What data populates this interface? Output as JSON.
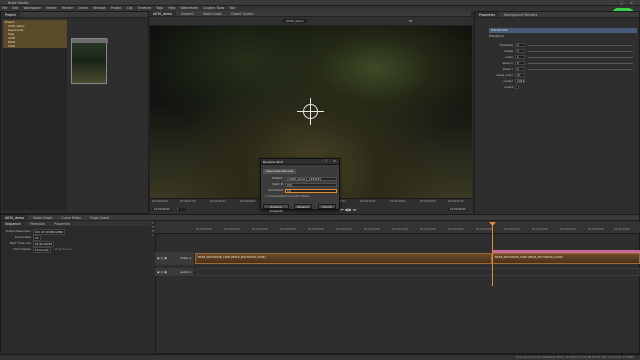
{
  "app": {
    "title": "Nuke Studio"
  },
  "menu": [
    "File",
    "Edit",
    "Workspace",
    "Viewer",
    "Render",
    "Cache",
    "Window",
    "Project",
    "Clip",
    "Timeline",
    "Tags",
    "Help",
    "Watermark",
    "Custom Tools",
    "Tool"
  ],
  "project_panel": {
    "tabs": [
      "Project"
    ],
    "bins": [
      "Project",
      "A030_demo",
      "Sequences",
      "Tags",
      "A030",
      "B001",
      "C001"
    ]
  },
  "viewer": {
    "tabs": [
      "A030_demo",
      "Viewer1",
      "Node Graph",
      "Export Queue"
    ],
    "clip_tab": "A030_demo",
    "zoom": "Fit",
    "timecodes": [
      "01:00:00:00",
      "01:00:01:00",
      "01:00:05:01",
      "01:00:09:01",
      "01:00:13:01",
      "01:00:17:01",
      "01:00:21:01",
      "01:00:25:01",
      "01:00:29:01",
      "01:00:33:01",
      "01:00:37:01",
      "01:00:00:00",
      "01:00:00:00"
    ],
    "frame_field": "1"
  },
  "properties": {
    "tabs": [
      "Properties",
      "Background Renders"
    ],
    "node_name": "Transform1",
    "section": "Transform",
    "params": [
      {
        "label": "translate",
        "value": "0"
      },
      {
        "label": "rotate",
        "value": "0"
      },
      {
        "label": "scale",
        "value": "1"
      },
      {
        "label": "skew X",
        "value": "0"
      },
      {
        "label": "skew Y",
        "value": "0"
      },
      {
        "label": "skew order",
        "value": "XY"
      },
      {
        "label": "center",
        "value": "1024"
      },
      {
        "label": "invert",
        "value": ""
      }
    ]
  },
  "timeline": {
    "tabs": [
      "A030_demo",
      "Node Graph",
      "Curve Editor",
      "Dope Sheet"
    ],
    "info_tabs": [
      "Sequence",
      "Metadata",
      "Properties"
    ],
    "info_rows": [
      {
        "label": "Output Resolution",
        "value": "DCI 2K (2048x1080)"
      },
      {
        "label": "Frame Rate",
        "value": "24"
      },
      {
        "label": "Start Timecode",
        "value": "01:00:00:00"
      },
      {
        "label": "Time Display",
        "value": "Timecode"
      }
    ],
    "drop_frame": "Drop Frame",
    "ruler": [
      "01:00:00:00",
      "01:00:02:00",
      "01:00:04:00",
      "01:00:06:00",
      "01:00:08:00",
      "01:00:10:00",
      "01:00:12:00",
      "01:00:14:00",
      "01:00:16:00",
      "01:00:18:00",
      "01:00:20:00",
      "01:00:22:00",
      "01:00:24:00",
      "01:00:26:00",
      "01:00:28:00",
      "01:00:30:00"
    ],
    "tracks": [
      {
        "name": "Video 1",
        "type": "video"
      },
      {
        "name": "Audio 1",
        "type": "audio"
      }
    ],
    "clip_label_1": "B018_M4702028_C006 [B018_M4702028_C006]",
    "clip_label_2": "B018_M4702028_C006 [B018_M4702028_C006]"
  },
  "dialog": {
    "title": "Rename Shot",
    "tab": "Sequential Rename",
    "rows": [
      {
        "label": "Pattern",
        "value": "{A030_demo}_{####}"
      },
      {
        "label": "Start #",
        "value": "010"
      },
      {
        "label": "Increment",
        "value": "10"
      }
    ],
    "checkbox": "Include Clips from Audio Tracks",
    "buttons": [
      "Rename Snapshot",
      "Rename",
      "Cancel"
    ]
  },
  "status": "Channel Count: 10  Localization Mode: On  Memory: 0.8 GB (9.4%)  CPU: 4.1%  Disk: 0.0 MB/s"
}
